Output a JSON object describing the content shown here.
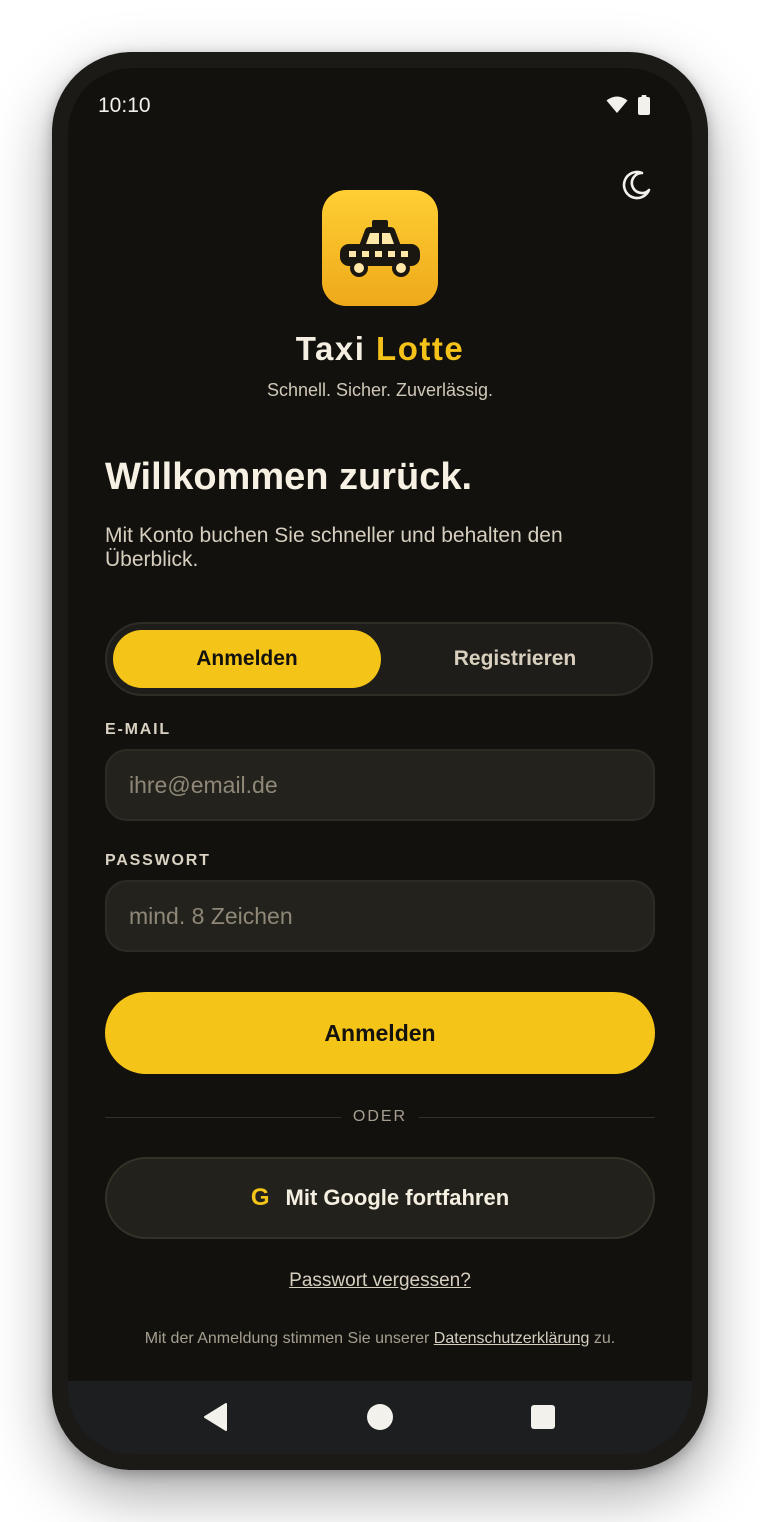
{
  "status_bar": {
    "time": "10:10",
    "wifi_icon": "wifi-icon",
    "battery_icon": "battery-icon"
  },
  "theme_toggle": {
    "icon": "moon-icon"
  },
  "app": {
    "logo_icon": "taxi-icon",
    "name_part1": "Taxi",
    "name_part2": "Lotte",
    "tagline": "Schnell. Sicher. Zuverlässig."
  },
  "welcome": {
    "title": "Willkommen zurück.",
    "subtitle": "Mit Konto buchen Sie schneller und behalten den Überblick."
  },
  "auth_tabs": [
    {
      "label": "Anmelden",
      "active": true
    },
    {
      "label": "Registrieren",
      "active": false
    }
  ],
  "form": {
    "email": {
      "label": "E-MAIL",
      "value": "",
      "placeholder": "ihre@email.de"
    },
    "password": {
      "label": "PASSWORT",
      "value": "",
      "placeholder": "mind. 8 Zeichen"
    },
    "submit_label": "Anmelden"
  },
  "divider_label": "ODER",
  "google": {
    "icon_letter": "G",
    "label": "Mit Google fortfahren"
  },
  "forgot_password": "Passwort vergessen?",
  "legal": {
    "prefix": "Mit der Anmeldung stimmen Sie unserer",
    "link": "Datenschutzerklärung",
    "suffix": "zu."
  },
  "nav_bar": {
    "back_icon": "back-icon",
    "home_icon": "home-icon",
    "recents_icon": "recents-icon"
  },
  "colors": {
    "accent": "#f4c418",
    "background": "#12110e",
    "surface": "#24221d",
    "text": "#f5efe2"
  }
}
